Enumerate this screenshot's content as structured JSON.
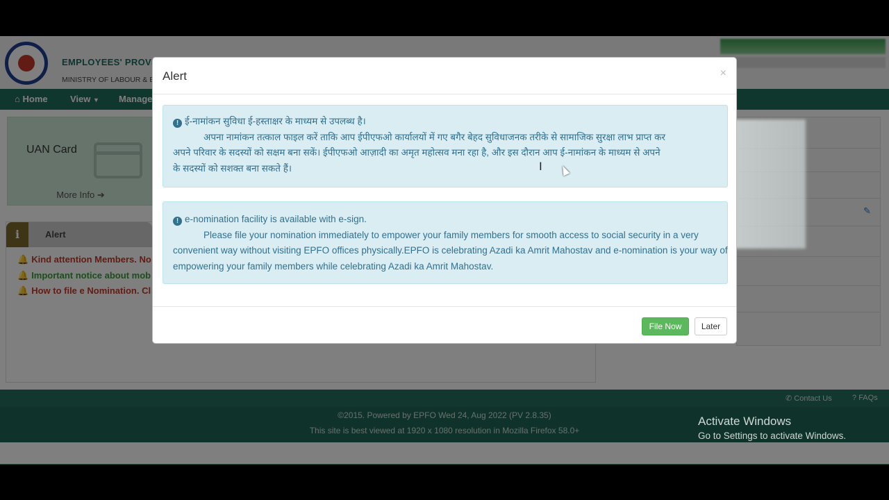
{
  "header": {
    "org_title": "EMPLOYEES' PROVID",
    "org_subtitle": "MINISTRY OF LABOUR & E"
  },
  "nav": {
    "home": "Home",
    "view": "View",
    "manage": "Manage"
  },
  "uan_card": {
    "title": "UAN Card",
    "more_info": "More Info"
  },
  "alert_panel": {
    "tab_icon": "i",
    "tab_label": "Alert",
    "notices": [
      {
        "text": "Kind attention Members. No",
        "color": "#c0392b"
      },
      {
        "text": "Important notice about mob",
        "color": "#3a9a3a"
      },
      {
        "text": "How to file e Nomination. Cl",
        "color": "#c0392b"
      }
    ]
  },
  "footer": {
    "contact_us": "Contact Us",
    "faqs": "FAQs",
    "copyright": "©2015. Powered by EPFO Wed 24, Aug 2022 (PV 2.8.35)",
    "best_viewed": "This site is best viewed at 1920 x 1080 resolution in Mozilla Firefox 58.0+"
  },
  "watermark": {
    "title": "Activate Windows",
    "subtitle": "Go to Settings to activate Windows."
  },
  "modal": {
    "title": "Alert",
    "close": "×",
    "hindi": {
      "heading": "ई-नामांकन सुविधा ई-हस्ताक्षर के माध्यम से उपलब्ध है।",
      "line1": "अपना नामांकन तत्काल फाइल करें ताकि आप ईपीएफओ कार्यालयों में गए बगैर बेहद सुविधाजनक तरीके से सामाजिक सुरक्षा लाभ प्राप्त कर",
      "line2": "अपने परिवार के सदस्यों को सक्षम बना सकें। ईपीएफओ आज़ादी का अमृत महोत्सव मना रहा है, और इस दौरान आप ई-नामांकन के माध्यम से अपने",
      "line3": "के सदस्यों को सशक्त बना सकते हैं।"
    },
    "english": {
      "heading": "e-nomination facility is available with e-sign.",
      "line1": "Please file your nomination immediately to empower your family members for smooth access to social security in a very",
      "line2": "convenient way without visiting EPFO offices physically.EPFO is celebrating Azadi ka Amrit Mahostav and e-nomination is your way of",
      "line3": "empowering your family members while celebrating Azadi ka Amrit Mahostav."
    },
    "file_now": "File Now",
    "later": "Later"
  }
}
